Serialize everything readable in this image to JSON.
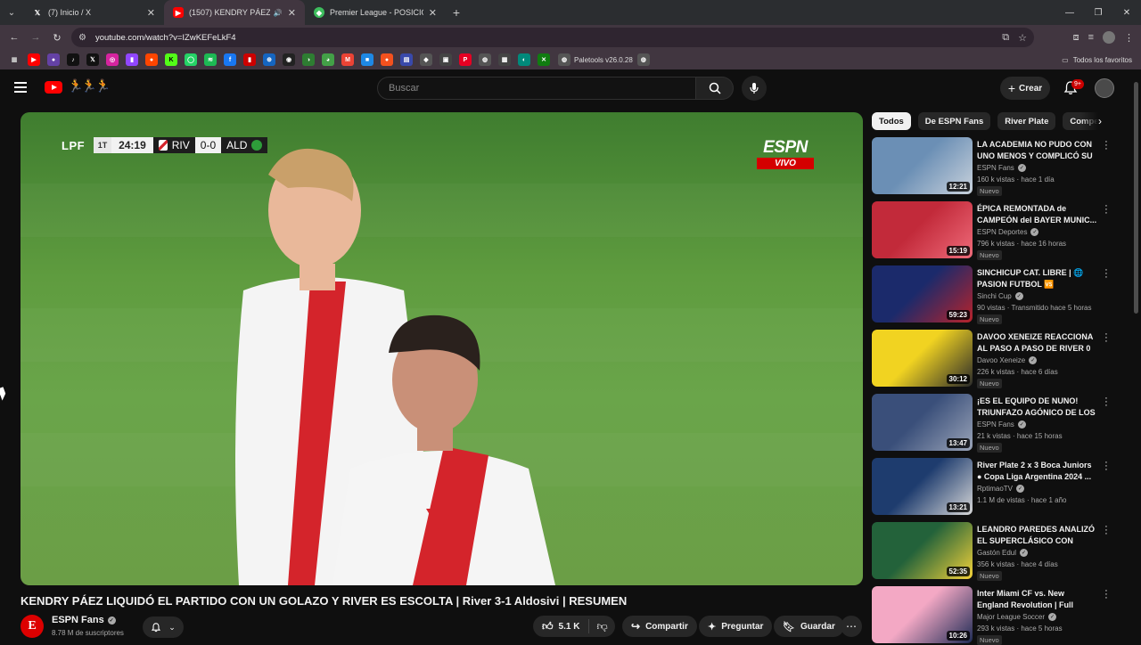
{
  "browser": {
    "tabs": [
      {
        "label": "(7) Inicio / X",
        "favicon": "x-logo-icon",
        "active": false
      },
      {
        "label": "(1507) KENDRY PÁEZ LIQUI",
        "favicon": "youtube-icon",
        "active": true
      },
      {
        "label": "Premier League - POSICIONES",
        "favicon": "premier-league-icon",
        "active": false
      }
    ],
    "url": "youtube.com/watch?v=IZwKEFeLkF4",
    "bookmarks_extension_label": "Paletools v26.0.28",
    "bookmarks_folder_label": "Todos los favoritos"
  },
  "youtube": {
    "search_placeholder": "Buscar",
    "create_label": "Crear",
    "notification_count": "9+"
  },
  "video": {
    "scorebug": {
      "league": "LPF",
      "half": "1T",
      "clock": "24:19",
      "home": "RIV",
      "score": "0-0",
      "away": "ALD"
    },
    "broadcaster": "ESPN",
    "live_label": "VIVO",
    "title": "KENDRY PÁEZ LIQUIDÓ EL PARTIDO CON UN GOLAZO Y RIVER ES ESCOLTA | River 3-1 Aldosivi | RESUMEN",
    "channel": {
      "name": "ESPN Fans",
      "avatar_letter": "E",
      "subscribers": "8.78 M de suscriptores"
    },
    "actions": {
      "likes": "5.1 K",
      "share": "Compartir",
      "ask": "Preguntar",
      "save": "Guardar"
    }
  },
  "chips": [
    "Todos",
    "De ESPN Fans",
    "River Plate",
    "Compe"
  ],
  "recommendations": [
    {
      "title": "LA ACADEMIA NO PUDO CON UNO MENOS Y COMPLICÓ SU ...",
      "channel": "ESPN Fans",
      "meta": "160 k vistas · hace 1 día",
      "badge": "Nuevo",
      "duration": "12:21",
      "colors": [
        "#6b8fb5",
        "#c9d2dc"
      ]
    },
    {
      "title": "ÉPICA REMONTADA de CAMPEÓN del BAYER MUNIC...",
      "channel": "ESPN Deportes",
      "meta": "796 k vistas · hace 16 horas",
      "badge": "Nuevo",
      "duration": "15:19",
      "colors": [
        "#c22a3a",
        "#ef6b7a"
      ]
    },
    {
      "title": "SINCHICUP  CAT. LIBRE | 🌐 PASION FUTBOL 🆚 FUTSPOR...",
      "channel": "Sinchi Cup",
      "meta": "90 vistas · Transmitido hace 5 horas",
      "badge": "Nuevo",
      "duration": "59:23",
      "colors": [
        "#1b2a6b",
        "#b8232b"
      ]
    },
    {
      "title": "DAVOO XENEIZE REACCIONA AL PASO A PASO DE RIVER 0 ...",
      "channel": "Davoo Xeneize",
      "meta": "226 k vistas · hace 6 días",
      "badge": "Nuevo",
      "duration": "30:12",
      "colors": [
        "#f1d321",
        "#2a2a2a"
      ]
    },
    {
      "title": "¡ES EL EQUIPO DE NUNO! TRIUNFAZO AGÓNICO DE LOS ...",
      "channel": "ESPN Fans",
      "meta": "21 k vistas · hace 15 horas",
      "badge": "Nuevo",
      "duration": "13:47",
      "colors": [
        "#3a4f7a",
        "#9aa4b8"
      ]
    },
    {
      "title": "River Plate 2 x 3 Boca Juniors ● Copa Liga Argentina 2024 ...",
      "channel": "RptimaoTV",
      "meta": "1.1 M de vistas · hace 1 año",
      "badge": "",
      "duration": "13:21",
      "colors": [
        "#1e3c6e",
        "#d8d8d8"
      ]
    },
    {
      "title": "LEANDRO PAREDES ANALIZÓ EL SUPERCLÁSICO CON DAVO...",
      "channel": "Gastón Edul",
      "meta": "356 k vistas · hace 4 días",
      "badge": "Nuevo",
      "duration": "52:35",
      "colors": [
        "#23623a",
        "#f3d23a"
      ]
    },
    {
      "title": "Inter Miami CF vs. New England Revolution | Full Match ...",
      "channel": "Major League Soccer",
      "meta": "293 k vistas · hace 5 horas",
      "badge": "Nuevo",
      "duration": "10:26",
      "colors": [
        "#f3a8c4",
        "#1e2b55"
      ]
    }
  ]
}
